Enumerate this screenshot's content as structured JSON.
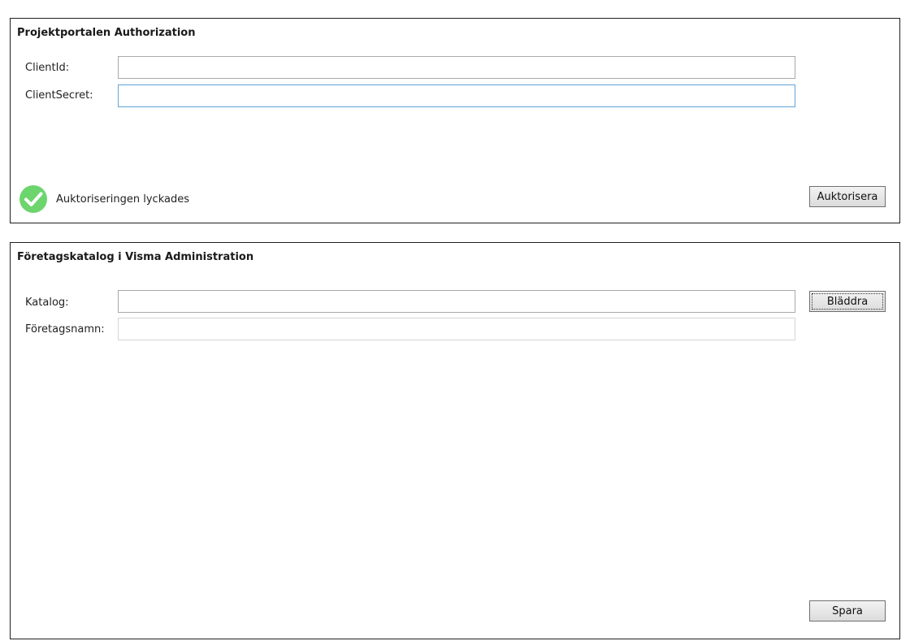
{
  "auth_panel": {
    "title": "Projektportalen Authorization",
    "client_id_label": "ClientId:",
    "client_id_value": "",
    "client_secret_label": "ClientSecret:",
    "client_secret_value": "",
    "status_text": "Auktoriseringen lyckades",
    "status_icon": "check-circle-icon",
    "status_color": "#6dd56d",
    "authorize_label": "Auktorisera"
  },
  "catalog_panel": {
    "title": "Företagskatalog i Visma Administration",
    "catalog_label": "Katalog:",
    "catalog_value": "",
    "browse_label": "Bläddra",
    "company_name_label": "Företagsnamn:",
    "company_name_value": "",
    "save_label": "Spara"
  }
}
